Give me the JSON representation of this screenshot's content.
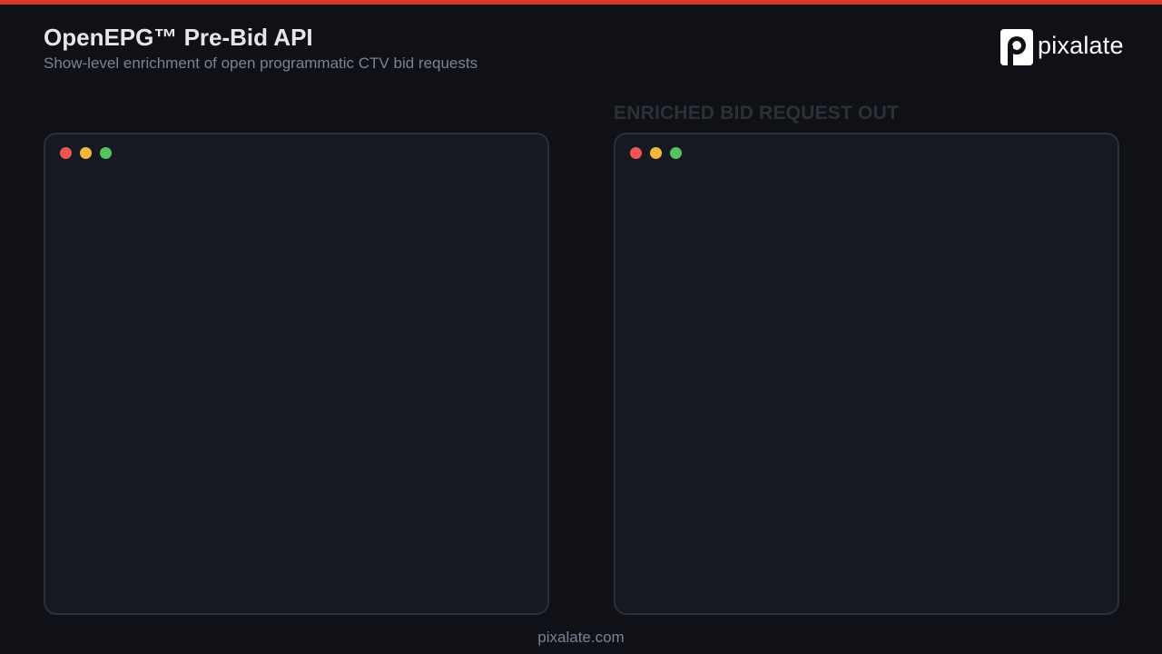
{
  "header": {
    "title": "OpenEPG™ Pre-Bid API",
    "subtitle": "Show-level enrichment of open programmatic CTV bid requests"
  },
  "logo": {
    "text": "pixalate",
    "icon": "pixalate-logo-icon"
  },
  "panels": {
    "left": {
      "label": ""
    },
    "right": {
      "label": "ENRICHED BID REQUEST OUT"
    }
  },
  "window_controls": {
    "close_color": "#ed5555",
    "minimize_color": "#f4b73c",
    "maximize_color": "#58c25f"
  },
  "colors": {
    "accent": "#d9392b",
    "background": "#101117",
    "panel": "#171922"
  },
  "footer": {
    "text": "pixalate.com"
  }
}
